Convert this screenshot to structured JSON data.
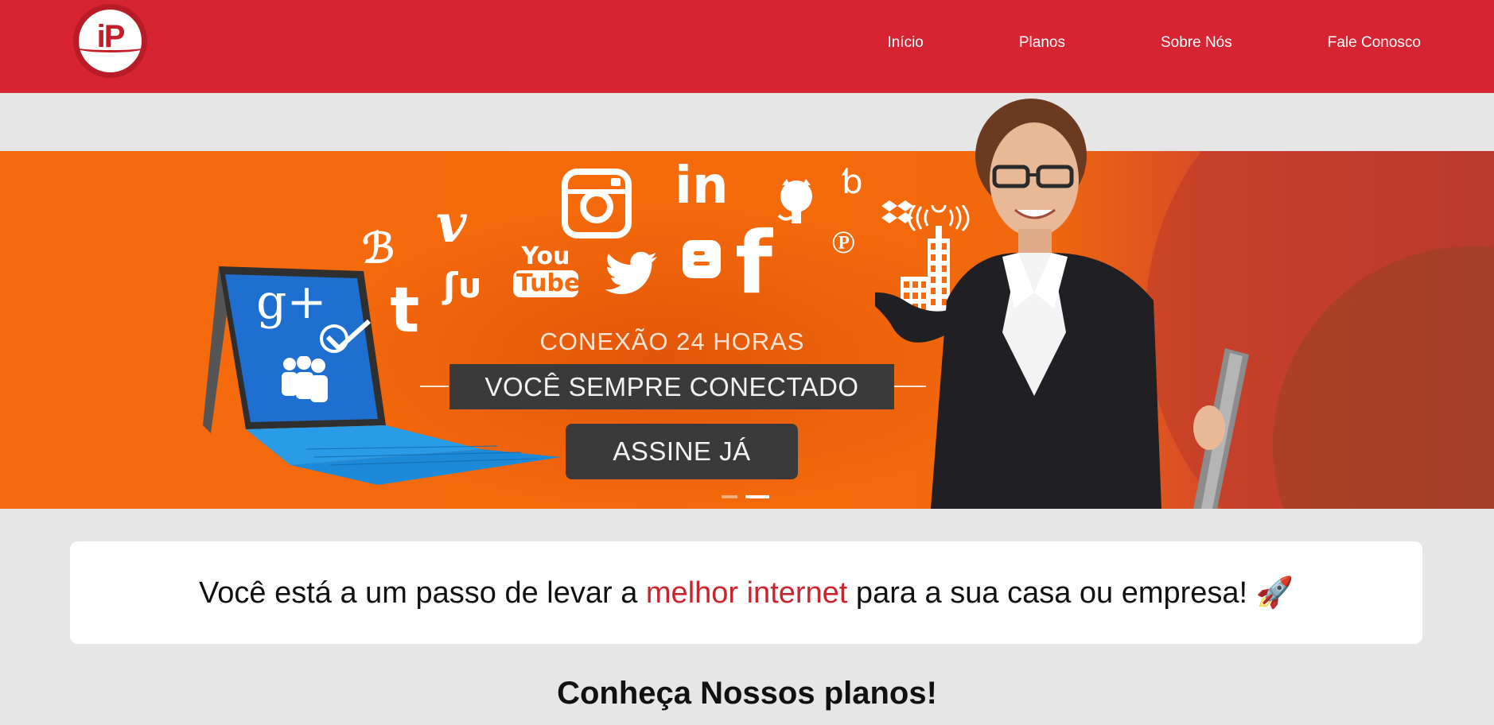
{
  "brand": {
    "logo_text": "iP",
    "header_color": "#d62432",
    "accent": "#c8252f"
  },
  "nav": {
    "items": [
      {
        "label": "Início"
      },
      {
        "label": "Planos"
      },
      {
        "label": "Sobre Nós"
      },
      {
        "label": "Fale Conosco"
      }
    ]
  },
  "banner": {
    "tagline": "CONEXÃO 24 HORAS",
    "headline": "VOCÊ SEMPRE CONECTADO",
    "cta": "ASSINE JÁ",
    "social_icons": [
      "blogger-icon",
      "vimeo-icon",
      "instagram-icon",
      "linkedin-icon",
      "github-icon",
      "behance-icon",
      "dropbox-icon",
      "pinterest-icon",
      "tumblr-icon",
      "stumbleupon-icon",
      "youtube-icon",
      "twitter-icon",
      "blogger-b-icon",
      "facebook-icon",
      "google-plus-icon",
      "myspace-icon",
      "signal-tower-icon",
      "building-icon"
    ],
    "youtube_text": [
      "You",
      "Tube"
    ],
    "slides": {
      "count": 2,
      "active": 2
    }
  },
  "intro": {
    "before": "Você está a um passo de levar a ",
    "highlight": "melhor internet",
    "after": " para a sua casa ou empresa! ",
    "emoji": "🚀"
  },
  "plans": {
    "title": "Conheça Nossos planos!"
  }
}
